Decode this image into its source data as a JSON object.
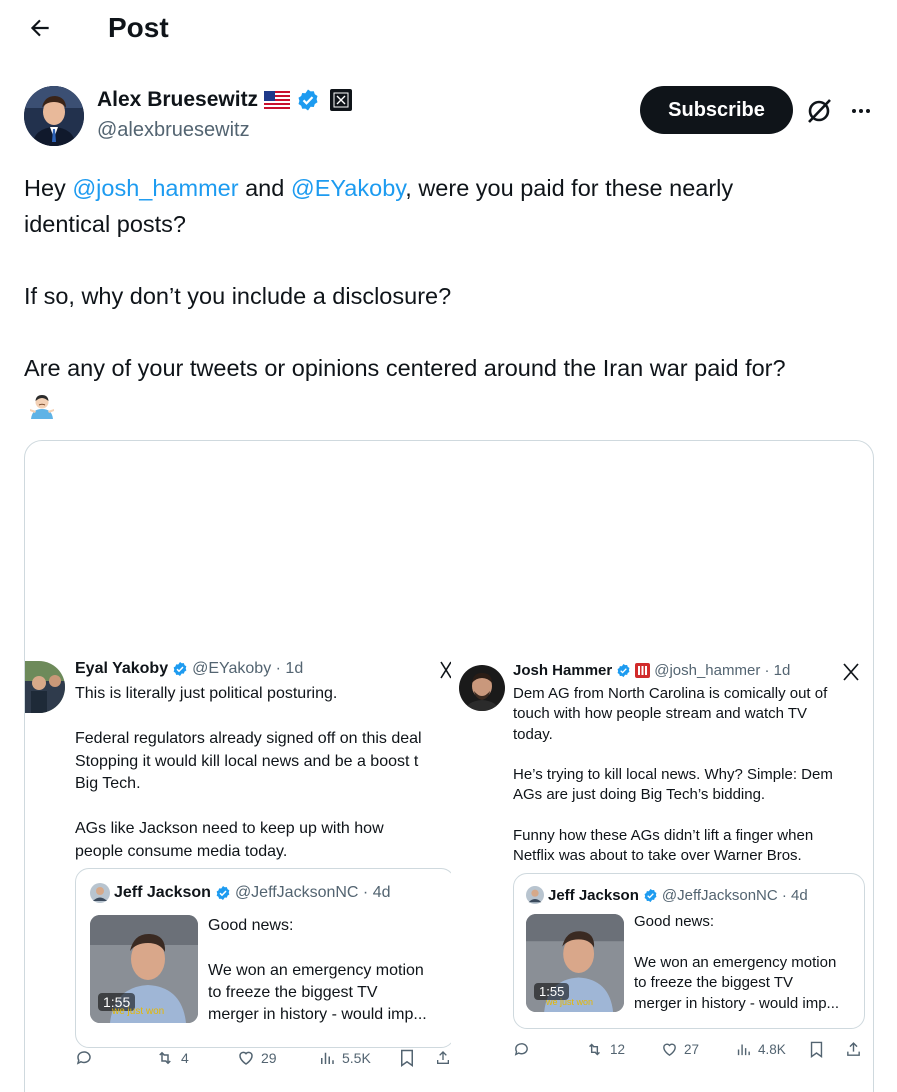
{
  "header": {
    "back_icon": "arrow-left-icon",
    "title": "Post"
  },
  "author": {
    "name": "Alex Bruesewitz",
    "handle": "@alexbruesewitz",
    "badges": [
      "us-flag-icon",
      "verified-badge-icon",
      "affiliate-x-icon"
    ],
    "verified_color": "#1d9bf0",
    "subscribe_label": "Subscribe"
  },
  "post": {
    "line1_pre": "Hey ",
    "mention1": "@josh_hammer",
    "line1_mid": " and ",
    "mention2": "@EYakoby",
    "line1_post": ", were you paid for these nearly",
    "line2": "identical posts?",
    "line3": "If so, why don’t you include a disclosure?",
    "line4": "Are any of your tweets or opinions centered around the Iran war paid for?",
    "emoji": "person-shrugging-emoji"
  },
  "embeds": {
    "left": {
      "name": "Eyal Yakoby",
      "meta": "@EYakoby · 1d",
      "body": "This is literally just political posturing.\n\nFederal regulators already signed off on this deal\nStopping it would kill local news and be a boost t\nBig Tech.\n\nAGs like Jackson need to keep up with how\npeople consume media today.",
      "quote": {
        "name": "Jeff Jackson",
        "meta": "@JeffJacksonNC · 4d",
        "line1": "Good news:",
        "line2": "We won an emergency motion",
        "line3": "to freeze the biggest TV",
        "line4": "merger in history - would imp...",
        "duration": "1:55",
        "caption": "we just won"
      },
      "stats": {
        "replies": "",
        "reposts": "4",
        "likes": "29",
        "views": "5.5K"
      }
    },
    "right": {
      "name": "Josh Hammer",
      "meta": "@josh_hammer · 1d",
      "body": "Dem AG from North Carolina is comically out of\ntouch with how people stream and watch TV\ntoday.\n\nHe’s trying to kill local news. Why? Simple: Dem\nAGs are just doing Big Tech’s bidding.\n\nFunny how these AGs didn’t lift a finger when\nNetflix was about to take over Warner Bros.",
      "quote": {
        "name": "Jeff Jackson",
        "meta": "@JeffJacksonNC · 4d",
        "line1": "Good news:",
        "line2": "We won an emergency motion",
        "line3": "to freeze the biggest TV",
        "line4": "merger in history - would imp...",
        "duration": "1:55",
        "caption": "we just won"
      },
      "stats": {
        "replies": "",
        "reposts": "12",
        "likes": "27",
        "views": "4.8K"
      }
    }
  }
}
